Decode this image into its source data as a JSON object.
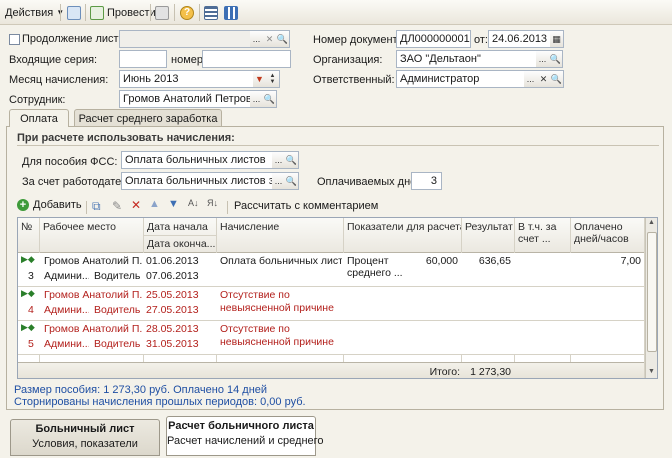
{
  "toolbar": {
    "actions_label": "Действия",
    "post_label": "Провести"
  },
  "form": {
    "continuation_label": "Продолжение листка",
    "continuation_value": "",
    "incoming_series_label": "Входящие серия:",
    "incoming_series_value": "",
    "number_label": "номер:",
    "number_value": "",
    "accrual_month_label": "Месяц начисления:",
    "accrual_month_value": "Июнь 2013",
    "employee_label": "Сотрудник:",
    "employee_value": "Громов Анатолий Петрович",
    "doc_number_label": "Номер документа:",
    "doc_number_value": "ДЛ000000001",
    "date_from_label": "от:",
    "date_value": "24.06.2013",
    "organization_label": "Организация:",
    "organization_value": "ЗАО \"Дельтаон\"",
    "responsible_label": "Ответственный:",
    "responsible_value": "Администратор"
  },
  "tabs": [
    "Оплата",
    "Расчет среднего заработка"
  ],
  "payment": {
    "section_title": "При расчете использовать начисления:",
    "fss_label": "Для пособия ФСС:",
    "fss_value": "Оплата больничных листов",
    "employer_label": "За счет работодателя:",
    "employer_value": "Оплата больничных листов за сче",
    "paid_days_label": "Оплачиваемых дней:",
    "paid_days_value": "3",
    "add_label": "Добавить",
    "recalc_label": "Рассчитать с комментарием"
  },
  "grid": {
    "headers": {
      "num": "№",
      "workplace": "Рабочее место",
      "date_start": "Дата начала",
      "date_end": "Дата оконча...",
      "accrual": "Начисление",
      "indicators": "Показатели для расчета",
      "result": "Результат",
      "incl_account": "В т.ч. за счет ...",
      "paid_days": "Оплачено дней/часов"
    },
    "rows": [
      {
        "num": "3",
        "employee": "Громов Анатолий П...",
        "place": "Админи...",
        "position": "Водитель",
        "start": "01.06.2013",
        "end": "07.06.2013",
        "accrual": "Оплата больничных листов",
        "indicator": "Процент среднего ...",
        "indicator_value": "60,000",
        "result": "636,65",
        "paid": "7,00",
        "storno": false
      },
      {
        "num": "4",
        "employee": "Громов Анатолий П...",
        "place": "Админи...",
        "position": "Водитель",
        "start": "25.05.2013",
        "end": "27.05.2013",
        "accrual": "Отсутствие по невыясненной причине",
        "indicator": "",
        "indicator_value": "",
        "result": "",
        "paid": "",
        "storno": true
      },
      {
        "num": "5",
        "employee": "Громов Анатолий П...",
        "place": "Админи...",
        "position": "Водитель",
        "start": "28.05.2013",
        "end": "31.05.2013",
        "accrual": "Отсутствие по невыясненной причине",
        "indicator": "",
        "indicator_value": "",
        "result": "",
        "paid": "",
        "storno": true
      }
    ],
    "total_label": "Итого:",
    "total_value": "1 273,30"
  },
  "summary": {
    "line1": "Размер пособия: 1 273,30 руб. Оплачено 14 дней",
    "line2": "Сторнированы начисления прошлых периодов: 0,00 руб."
  },
  "bottom_tabs": [
    {
      "title": "Больничный лист",
      "subtitle": "Условия, показатели"
    },
    {
      "title": "Расчет больничного листа",
      "subtitle": "Расчет начислений и среднего"
    }
  ],
  "colors": {
    "storno_text": "#b3201c",
    "link_text": "#1f4fa3"
  }
}
